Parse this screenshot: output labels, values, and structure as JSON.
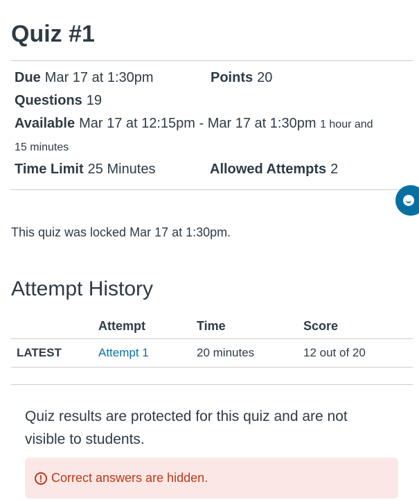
{
  "quiz": {
    "title": "Quiz #1",
    "due_label": "Due",
    "due_value": "Mar 17 at 1:30pm",
    "points_label": "Points",
    "points_value": "20",
    "questions_label": "Questions",
    "questions_value": "19",
    "available_label": "Available",
    "available_value": "Mar 17 at 12:15pm - Mar 17 at 1:30pm",
    "available_duration_a": "1 hour and",
    "available_duration_b": "15 minutes",
    "time_limit_label": "Time Limit",
    "time_limit_value": "25 Minutes",
    "attempts_label": "Allowed Attempts",
    "attempts_value": "2",
    "locked_text": "This quiz was locked Mar 17 at 1:30pm."
  },
  "history": {
    "heading": "Attempt History",
    "columns": [
      "",
      "Attempt",
      "Time",
      "Score"
    ],
    "rows": [
      {
        "status": "LATEST",
        "attempt": "Attempt 1",
        "time": "20 minutes",
        "score": "12 out of 20"
      }
    ]
  },
  "results": {
    "protected_text": "Quiz results are protected for this quiz and are not visible to students.",
    "alert_icon": "!",
    "alert_text": "Correct answers are hidden."
  },
  "icons": {
    "alert": "exclamation-circle-icon",
    "fab": "chat-bubble-icon"
  },
  "colors": {
    "text": "#2d3b45",
    "link": "#0770a3",
    "alert_text": "#c1361a",
    "alert_bg": "#fbe8e6",
    "fab_bg": "#0770a3"
  }
}
